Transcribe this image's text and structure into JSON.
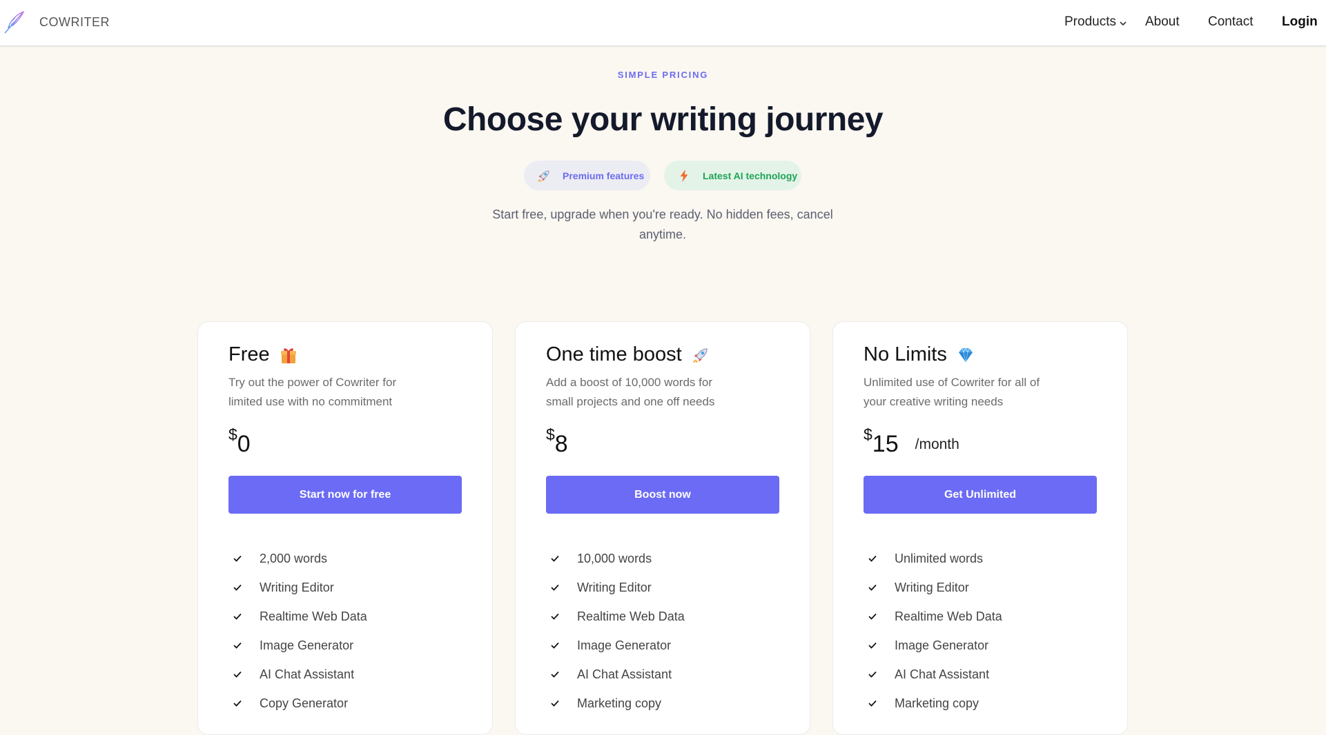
{
  "nav": {
    "brand": "COWRITER",
    "links": {
      "products": "Products",
      "about": "About",
      "contact": "Contact",
      "login": "Login"
    }
  },
  "hero": {
    "eyebrow": "SIMPLE PRICING",
    "title": "Choose your writing journey",
    "badges": {
      "premium": "Premium features",
      "ai": "Latest AI technology"
    },
    "subtitle": "Start free, upgrade when you're ready. No hidden fees, cancel anytime."
  },
  "plans": [
    {
      "name": "Free",
      "icon": "gift-icon",
      "description": "Try out the power of Cowriter for limited use with no commitment",
      "currency": "$",
      "price": "0",
      "period": "",
      "cta": "Start now for free",
      "features": [
        "2,000 words",
        "Writing Editor",
        "Realtime Web Data",
        "Image Generator",
        "AI Chat Assistant",
        "Copy Generator"
      ]
    },
    {
      "name": "One time boost",
      "icon": "rocket-icon",
      "description": "Add a boost of 10,000 words for small projects and one off needs",
      "currency": "$",
      "price": "8",
      "period": "",
      "cta": "Boost now",
      "features": [
        "10,000 words",
        "Writing Editor",
        "Realtime Web Data",
        "Image Generator",
        "AI Chat Assistant",
        "Marketing copy"
      ]
    },
    {
      "name": "No Limits",
      "icon": "gem-icon",
      "description": "Unlimited use of Cowriter for all of your creative writing needs",
      "currency": "$",
      "price": "15",
      "period": "/month",
      "cta": "Get Unlimited",
      "features": [
        "Unlimited words",
        "Writing Editor",
        "Realtime Web Data",
        "Image Generator",
        "AI Chat Assistant",
        "Marketing copy"
      ]
    }
  ],
  "colors": {
    "accent": "#6b6bf5",
    "page_background": "#fbf7f1",
    "premium_badge_text": "#6b6cf0",
    "ai_badge_text": "#1ea456"
  }
}
